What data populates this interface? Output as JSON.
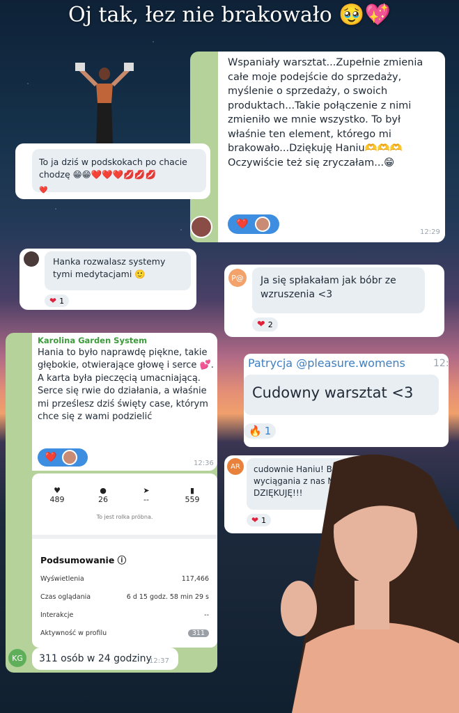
{
  "title": "Oj tak, łez nie brakowało 🥹💖",
  "msg_big": {
    "text": "Wspaniały warsztat...Zupełnie zmienia całe moje podejście do sprzedaży,  myślenie o sprzedaży, o swoich produktach...Takie połączenie z nimi zmieniło we mnie wszystko. To był właśnie ten element,  którego mi brakowało...Dziękuję Haniu🫶🫶🫶 Oczywiście też się zryczałam...😁",
    "time": "12:29",
    "reaction": "❤️"
  },
  "msg_jump": {
    "text": "To ja dziś w podskokach po chacie chodzę 😁😁❤️❤️❤️💋💋💋",
    "reaction": "❤️"
  },
  "msg_hanka": {
    "text": "Hanka rozwalasz systemy tymi medytacjami 🙂",
    "reaction_count": "1"
  },
  "msg_bobr": {
    "avatar": "P@",
    "text": "Ja się spłakałam jak bóbr ze wzruszenia <3",
    "reaction_count": "2"
  },
  "msg_karolina": {
    "sender": "Karolina Garden System",
    "text": "Hania to było naprawdę piękne, takie głębokie, otwierające głowę i serce 💕. A karta była pieczęcią umacniającą. Serce się rwie do działania, a właśnie mi prześlesz dziś święty case, którym chce się z wami podzielić",
    "time": "12:36",
    "reaction": "❤️"
  },
  "insights": {
    "likes": "489",
    "comments": "26",
    "shares": "--",
    "saves": "559",
    "note": "To jest rolka próbna.",
    "summary_title": "Podsumowanie",
    "rows": [
      {
        "label": "Wyświetlenia",
        "value": "117,466"
      },
      {
        "label": "Czas oglądania",
        "value": "6 d 15 godz. 58 min 29 s"
      },
      {
        "label": "Interakcje",
        "value": "--"
      },
      {
        "label": "Aktywność w profilu",
        "value": "311"
      }
    ],
    "badge_time": "12:36"
  },
  "msg_kg": {
    "avatar": "KG",
    "text": "311 osób w 24 godziny",
    "time": "12:37"
  },
  "msg_patrycja": {
    "sender": "Patrycja @pleasure.womens",
    "time": "12:",
    "text": "Cudowny warsztat <3",
    "reaction": "🔥",
    "reaction_count": "1"
  },
  "msg_ar": {
    "avatar": "AR",
    "text": "cudownie Haniu! Bogini wyciągania z nas Nas! DZIĘKUJĘ!!!",
    "reaction_count": "1"
  }
}
